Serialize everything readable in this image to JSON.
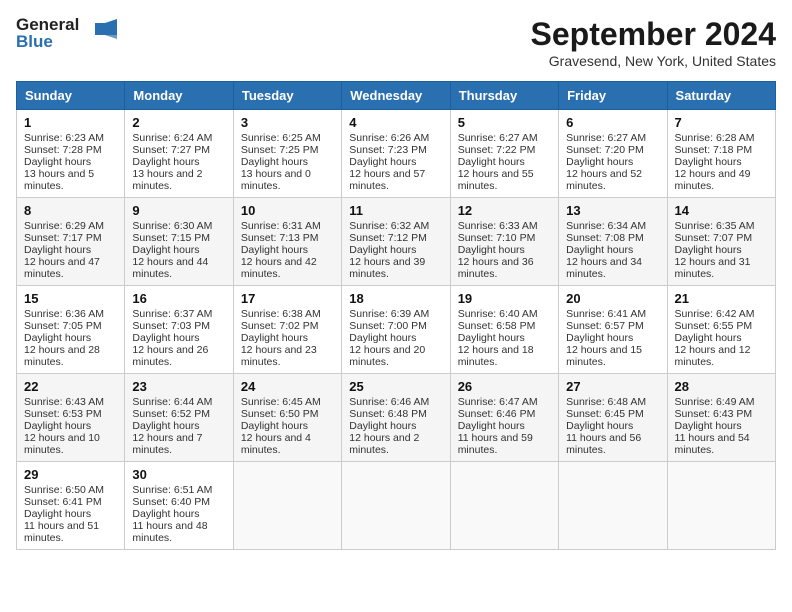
{
  "header": {
    "logo_line1": "General",
    "logo_line2": "Blue",
    "main_title": "September 2024",
    "subtitle": "Gravesend, New York, United States"
  },
  "columns": [
    "Sunday",
    "Monday",
    "Tuesday",
    "Wednesday",
    "Thursday",
    "Friday",
    "Saturday"
  ],
  "weeks": [
    [
      {
        "day": "1",
        "sunrise": "6:23 AM",
        "sunset": "7:28 PM",
        "daylight": "13 hours and 5 minutes."
      },
      {
        "day": "2",
        "sunrise": "6:24 AM",
        "sunset": "7:27 PM",
        "daylight": "13 hours and 2 minutes."
      },
      {
        "day": "3",
        "sunrise": "6:25 AM",
        "sunset": "7:25 PM",
        "daylight": "13 hours and 0 minutes."
      },
      {
        "day": "4",
        "sunrise": "6:26 AM",
        "sunset": "7:23 PM",
        "daylight": "12 hours and 57 minutes."
      },
      {
        "day": "5",
        "sunrise": "6:27 AM",
        "sunset": "7:22 PM",
        "daylight": "12 hours and 55 minutes."
      },
      {
        "day": "6",
        "sunrise": "6:27 AM",
        "sunset": "7:20 PM",
        "daylight": "12 hours and 52 minutes."
      },
      {
        "day": "7",
        "sunrise": "6:28 AM",
        "sunset": "7:18 PM",
        "daylight": "12 hours and 49 minutes."
      }
    ],
    [
      {
        "day": "8",
        "sunrise": "6:29 AM",
        "sunset": "7:17 PM",
        "daylight": "12 hours and 47 minutes."
      },
      {
        "day": "9",
        "sunrise": "6:30 AM",
        "sunset": "7:15 PM",
        "daylight": "12 hours and 44 minutes."
      },
      {
        "day": "10",
        "sunrise": "6:31 AM",
        "sunset": "7:13 PM",
        "daylight": "12 hours and 42 minutes."
      },
      {
        "day": "11",
        "sunrise": "6:32 AM",
        "sunset": "7:12 PM",
        "daylight": "12 hours and 39 minutes."
      },
      {
        "day": "12",
        "sunrise": "6:33 AM",
        "sunset": "7:10 PM",
        "daylight": "12 hours and 36 minutes."
      },
      {
        "day": "13",
        "sunrise": "6:34 AM",
        "sunset": "7:08 PM",
        "daylight": "12 hours and 34 minutes."
      },
      {
        "day": "14",
        "sunrise": "6:35 AM",
        "sunset": "7:07 PM",
        "daylight": "12 hours and 31 minutes."
      }
    ],
    [
      {
        "day": "15",
        "sunrise": "6:36 AM",
        "sunset": "7:05 PM",
        "daylight": "12 hours and 28 minutes."
      },
      {
        "day": "16",
        "sunrise": "6:37 AM",
        "sunset": "7:03 PM",
        "daylight": "12 hours and 26 minutes."
      },
      {
        "day": "17",
        "sunrise": "6:38 AM",
        "sunset": "7:02 PM",
        "daylight": "12 hours and 23 minutes."
      },
      {
        "day": "18",
        "sunrise": "6:39 AM",
        "sunset": "7:00 PM",
        "daylight": "12 hours and 20 minutes."
      },
      {
        "day": "19",
        "sunrise": "6:40 AM",
        "sunset": "6:58 PM",
        "daylight": "12 hours and 18 minutes."
      },
      {
        "day": "20",
        "sunrise": "6:41 AM",
        "sunset": "6:57 PM",
        "daylight": "12 hours and 15 minutes."
      },
      {
        "day": "21",
        "sunrise": "6:42 AM",
        "sunset": "6:55 PM",
        "daylight": "12 hours and 12 minutes."
      }
    ],
    [
      {
        "day": "22",
        "sunrise": "6:43 AM",
        "sunset": "6:53 PM",
        "daylight": "12 hours and 10 minutes."
      },
      {
        "day": "23",
        "sunrise": "6:44 AM",
        "sunset": "6:52 PM",
        "daylight": "12 hours and 7 minutes."
      },
      {
        "day": "24",
        "sunrise": "6:45 AM",
        "sunset": "6:50 PM",
        "daylight": "12 hours and 4 minutes."
      },
      {
        "day": "25",
        "sunrise": "6:46 AM",
        "sunset": "6:48 PM",
        "daylight": "12 hours and 2 minutes."
      },
      {
        "day": "26",
        "sunrise": "6:47 AM",
        "sunset": "6:46 PM",
        "daylight": "11 hours and 59 minutes."
      },
      {
        "day": "27",
        "sunrise": "6:48 AM",
        "sunset": "6:45 PM",
        "daylight": "11 hours and 56 minutes."
      },
      {
        "day": "28",
        "sunrise": "6:49 AM",
        "sunset": "6:43 PM",
        "daylight": "11 hours and 54 minutes."
      }
    ],
    [
      {
        "day": "29",
        "sunrise": "6:50 AM",
        "sunset": "6:41 PM",
        "daylight": "11 hours and 51 minutes."
      },
      {
        "day": "30",
        "sunrise": "6:51 AM",
        "sunset": "6:40 PM",
        "daylight": "11 hours and 48 minutes."
      },
      null,
      null,
      null,
      null,
      null
    ]
  ],
  "labels": {
    "sunrise": "Sunrise:",
    "sunset": "Sunset:",
    "daylight": "Daylight hours"
  }
}
